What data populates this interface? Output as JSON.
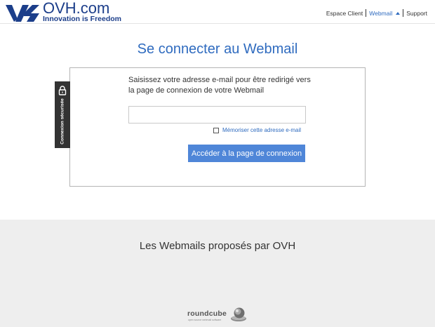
{
  "brand": {
    "name": "OVH.com",
    "tagline": "Innovation is Freedom",
    "color": "#1c3e8a"
  },
  "nav": {
    "items": [
      {
        "label": "Espace Client",
        "active": false
      },
      {
        "label": "Webmail",
        "active": true
      },
      {
        "label": "Support",
        "active": false
      }
    ]
  },
  "login": {
    "title": "Se connecter au Webmail",
    "secure_label": "Connexion sécurisée",
    "instructions": "Saisissez votre adresse e-mail pour être redirigé vers la page de connexion de votre Webmail",
    "email_value": "",
    "remember_label": "Mémoriser cette adresse e-mail",
    "remember_checked": false,
    "submit_label": "Accéder à la page de connexion",
    "accent": "#4f86d8"
  },
  "footer": {
    "title": "Les Webmails proposés par OVH",
    "webmails": [
      {
        "name": "roundcube",
        "subtitle": "open source webmail software",
        "icon": "roundcube-icon"
      }
    ]
  }
}
